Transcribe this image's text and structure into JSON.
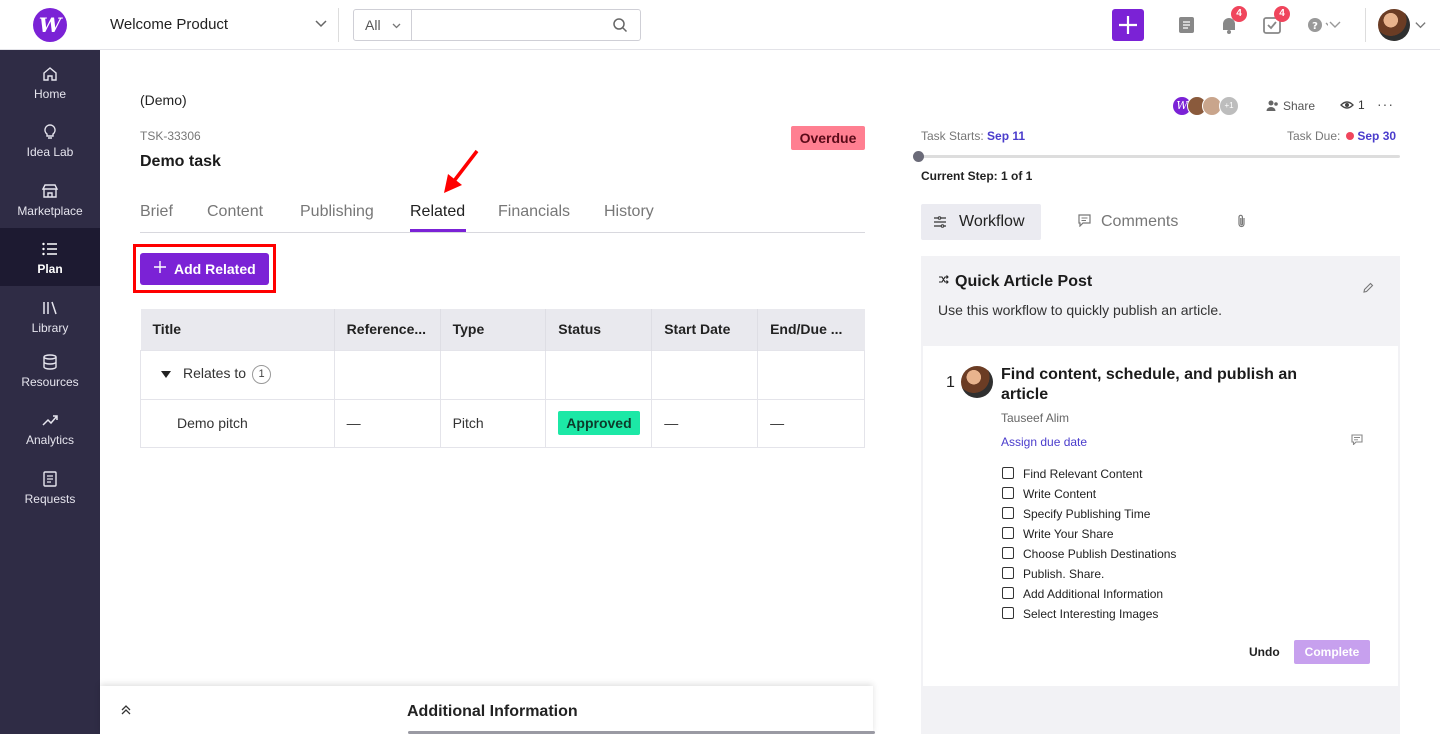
{
  "topbar": {
    "product_name": "Welcome Product",
    "search_scope": "All",
    "search_placeholder": "",
    "notifications_count": "4",
    "tasks_count": "4"
  },
  "sidebar": {
    "items": [
      {
        "label": "Home",
        "icon": "home-icon"
      },
      {
        "label": "Idea Lab",
        "icon": "lightbulb-icon"
      },
      {
        "label": "Marketplace",
        "icon": "store-icon"
      },
      {
        "label": "Plan",
        "icon": "list-icon"
      },
      {
        "label": "Library",
        "icon": "library-icon"
      },
      {
        "label": "Resources",
        "icon": "database-icon"
      },
      {
        "label": "Analytics",
        "icon": "trend-icon"
      },
      {
        "label": "Requests",
        "icon": "document-icon"
      }
    ]
  },
  "task": {
    "parent": "(Demo)",
    "id": "TSK-33306",
    "name": "Demo task",
    "status_badge": "Overdue"
  },
  "tabs": [
    "Brief",
    "Content",
    "Publishing",
    "Related",
    "Financials",
    "History"
  ],
  "add_related_label": "Add Related",
  "related_table": {
    "columns": [
      "Title",
      "Reference...",
      "Type",
      "Status",
      "Start Date",
      "End/Due ..."
    ],
    "group_label": "Relates to",
    "group_count": "1",
    "rows": [
      {
        "title": "Demo pitch",
        "reference": "—",
        "type": "Pitch",
        "status": "Approved",
        "start": "—",
        "end": "—"
      }
    ]
  },
  "additional_info_label": "Additional Information",
  "right_panel": {
    "collaborators_extra": "+1",
    "share_label": "Share",
    "viewers_count": "1",
    "more": "···",
    "task_starts_label": "Task Starts:",
    "task_starts_date": "Sep 11",
    "task_due_label": "Task Due:",
    "task_due_date": "Sep 30",
    "current_step": "Current Step: 1 of 1",
    "workflow_tab": "Workflow",
    "comments_tab": "Comments",
    "workflow_name": "Quick Article Post",
    "workflow_desc": "Use this workflow to quickly publish an article.",
    "step_number": "1",
    "step_title": "Find content, schedule, and publish an article",
    "step_assignee": "Tauseef Alim",
    "assign_due": "Assign due date",
    "checklist": [
      "Find Relevant Content",
      "Write Content",
      "Specify Publishing Time",
      "Write Your Share",
      "Choose Publish Destinations",
      "Publish. Share.",
      "Add Additional Information",
      "Select Interesting Images"
    ],
    "undo_label": "Undo",
    "complete_label": "Complete"
  },
  "colors": {
    "accent": "#7b22d6",
    "sidebar": "#2f2c45",
    "overdue": "#ff7f91",
    "approved": "#1ce8a6",
    "annotation_red": "#ff0000"
  }
}
